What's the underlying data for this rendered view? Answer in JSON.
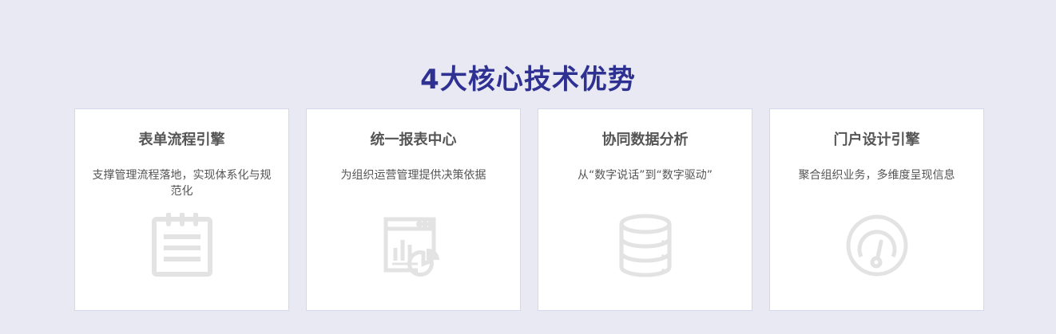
{
  "section": {
    "title": "4大核心技术优势"
  },
  "cards": [
    {
      "title": "表单流程引擎",
      "description": "支撑管理流程落地，实现体系化与规范化",
      "icon": "clipboard-form-icon"
    },
    {
      "title": "统一报表中心",
      "description": "为组织运营管理提供决策依据",
      "icon": "report-chart-icon"
    },
    {
      "title": "协同数据分析",
      "description": "从“数字说话”到“数字驱动”",
      "icon": "database-icon"
    },
    {
      "title": "门户设计引擎",
      "description": "聚合组织业务，多维度呈现信息",
      "icon": "gauge-dashboard-icon"
    }
  ],
  "colors": {
    "background": "#e9e9f4",
    "title": "#2e3192",
    "card_text": "#555555",
    "icon": "#e3e3e3",
    "card_border": "#d5d7ec"
  }
}
